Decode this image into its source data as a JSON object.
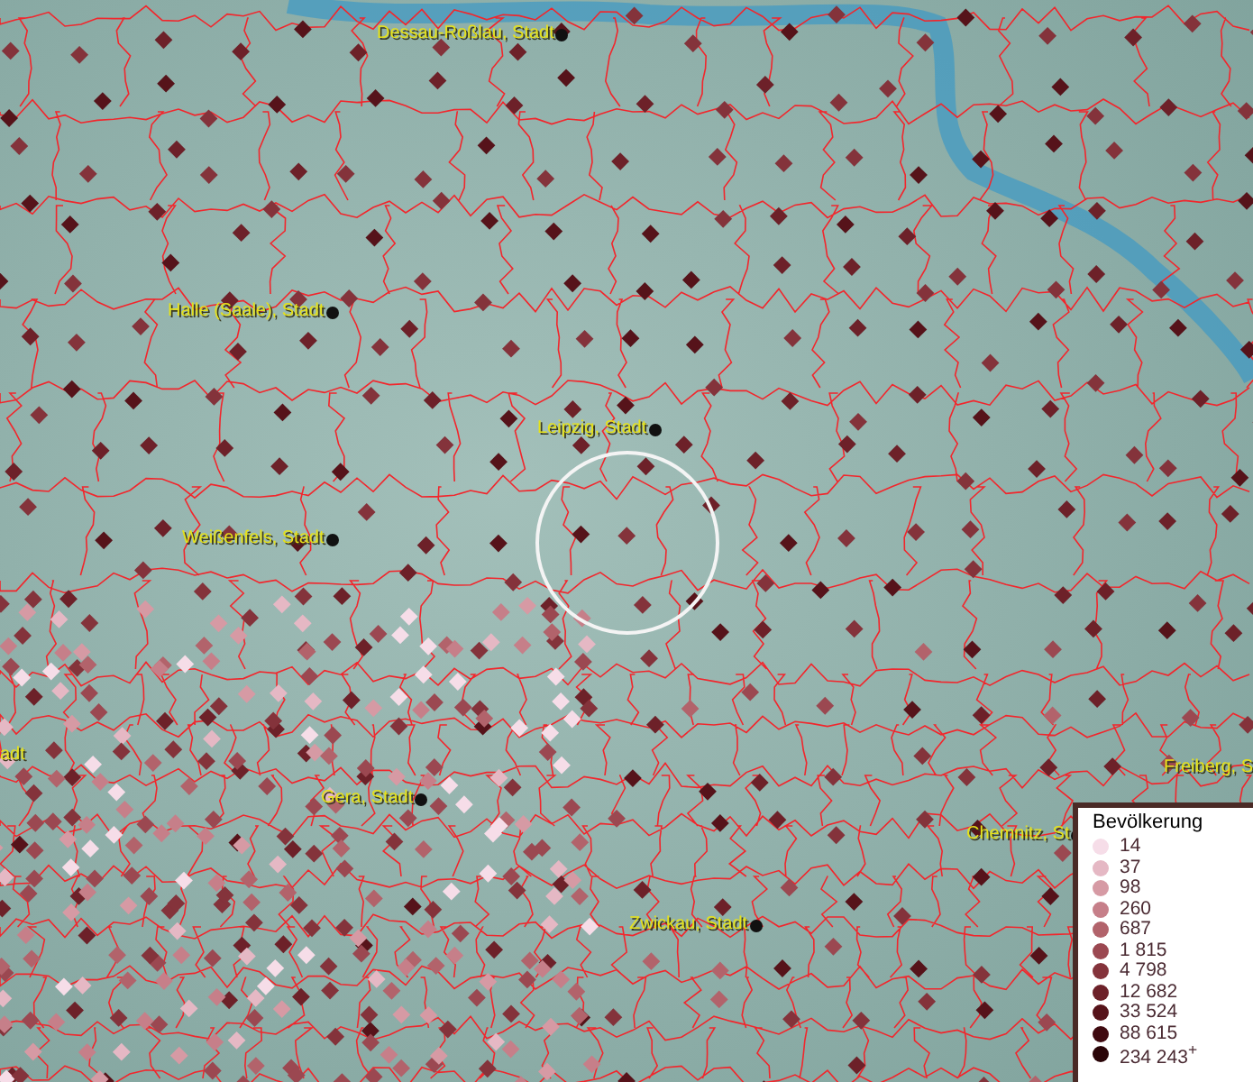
{
  "map": {
    "cities": [
      {
        "name": "Dessau-Roßlau, Stadt"
      },
      {
        "name": "Halle (Saale), Stadt"
      },
      {
        "name": "Leipzig, Stadt"
      },
      {
        "name": "Weißenfels, Stadt"
      },
      {
        "name": "adt"
      },
      {
        "name": "Freiberg, S"
      },
      {
        "name": "Gera, Stadt"
      },
      {
        "name": "Chemnitz, St"
      },
      {
        "name": "Zwickau, Stadt"
      }
    ]
  },
  "legend": {
    "title": "Bevölkerung",
    "classes": [
      {
        "label": "14",
        "color": "#f6dde8"
      },
      {
        "label": "37",
        "color": "#e5b8c4"
      },
      {
        "label": "98",
        "color": "#d69aa4"
      },
      {
        "label": "260",
        "color": "#c67f89"
      },
      {
        "label": "687",
        "color": "#b2636b"
      },
      {
        "label": "1 815",
        "color": "#9b4851"
      },
      {
        "label": "4 798",
        "color": "#84333b"
      },
      {
        "label": "12 682",
        "color": "#6d2129"
      },
      {
        "label": "33 524",
        "color": "#56131a"
      },
      {
        "label": "88 615",
        "color": "#3f0a10"
      },
      {
        "label": "234 243$^{+}$",
        "color": "#2a0508"
      }
    ]
  }
}
